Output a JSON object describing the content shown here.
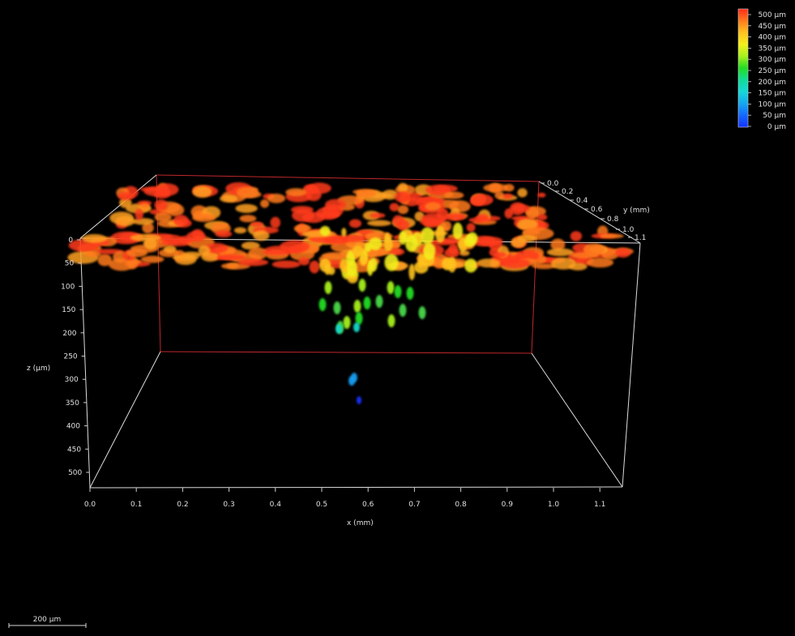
{
  "colorbar": {
    "labels": [
      "500 µm",
      "450 µm",
      "400 µm",
      "350 µm",
      "300 µm",
      "250 µm",
      "200 µm",
      "150 µm",
      "100 µm",
      "50 µm",
      "0 µm"
    ],
    "colors": [
      "#ff2a1a",
      "#ff7a1c",
      "#ffc21e",
      "#f4f01a",
      "#a6f01c",
      "#22dd22",
      "#10dd99",
      "#14d8d8",
      "#14a8f0",
      "#1468ff",
      "#1432ff"
    ]
  },
  "axes": {
    "x": {
      "title": "x (mm)",
      "ticks": [
        "0.0",
        "0.1",
        "0.2",
        "0.3",
        "0.4",
        "0.5",
        "0.6",
        "0.7",
        "0.8",
        "0.9",
        "1.0",
        "1.1"
      ]
    },
    "y": {
      "title": "y (mm)",
      "ticks": [
        "0.0",
        "0.2",
        "0.4",
        "0.6",
        "0.8",
        "1.0",
        "1.1"
      ]
    },
    "z": {
      "title": "z (µm)",
      "ticks": [
        "0",
        "50",
        "100",
        "150",
        "200",
        "250",
        "300",
        "350",
        "400",
        "450",
        "500"
      ]
    }
  },
  "scalebar": {
    "label": "200 µm"
  }
}
